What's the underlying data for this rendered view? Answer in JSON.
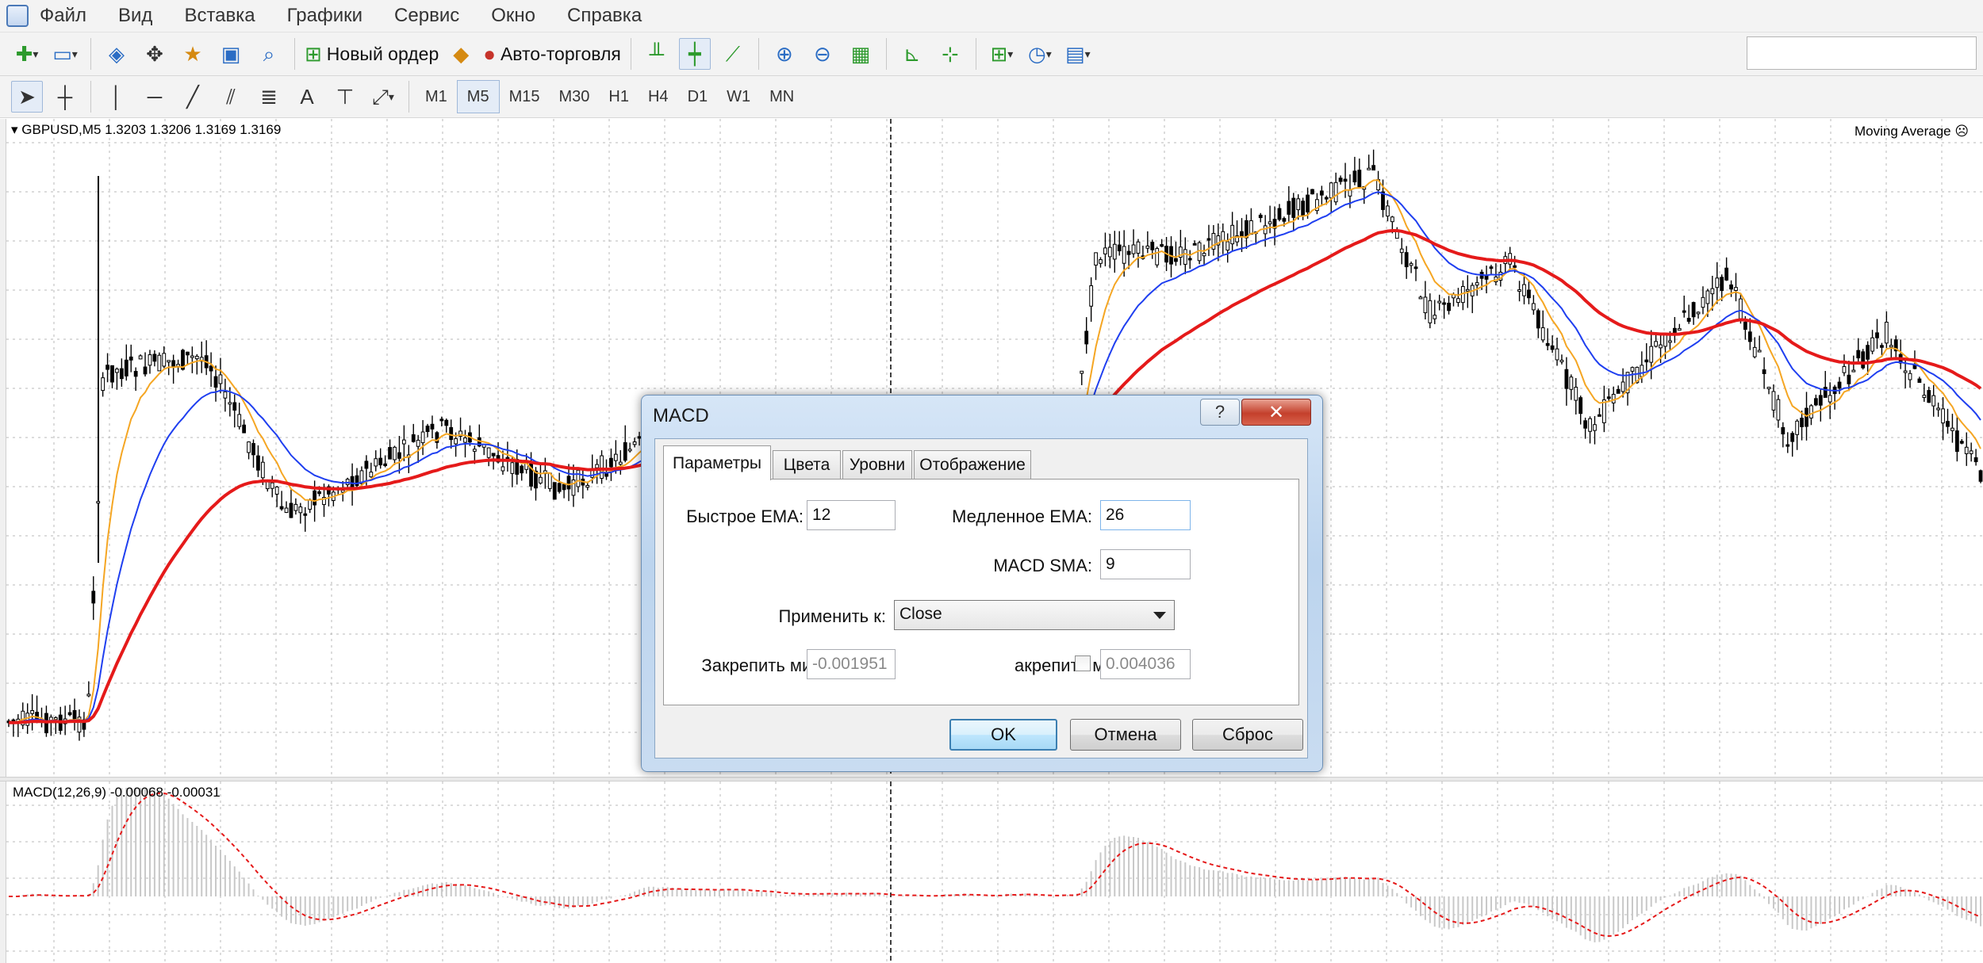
{
  "menu": [
    "Файл",
    "Вид",
    "Вставка",
    "Графики",
    "Сервис",
    "Окно",
    "Справка"
  ],
  "toolbar": {
    "new_order": "Новый ордер",
    "auto_trading": "Авто-торговля"
  },
  "timeframes": [
    "M1",
    "M5",
    "M15",
    "M30",
    "H1",
    "H4",
    "D1",
    "W1",
    "MN"
  ],
  "active_timeframe": "M5",
  "chart": {
    "symbol_info": "GBPUSD,M5  1.3203 1.3206 1.3169 1.3169",
    "indicator_label": "Moving Average",
    "macd_label": "MACD(12,26,9) -0.00068 -0.00031",
    "colors": {
      "fast_ma": "#f5a623",
      "mid_ma": "#1f3ff0",
      "slow_ma": "#e51a1a",
      "signal": "#e51a1a",
      "histogram": "#c8c8c8",
      "grid": "#b9b9b9"
    }
  },
  "dialog": {
    "title": "MACD",
    "help": "?",
    "close": "✕",
    "tabs": [
      "Параметры",
      "Цвета",
      "Уровни",
      "Отображение"
    ],
    "fast_ema_label": "Быстрое EMA:",
    "fast_ema_value": "12",
    "slow_ema_label": "Медленное EMA:",
    "slow_ema_value": "26",
    "macd_sma_label": "MACD SMA:",
    "macd_sma_value": "9",
    "apply_to_label": "Применить к:",
    "apply_to_value": "Close",
    "fix_min_label": "Закрепить минимум",
    "fix_min_value": "-0.001951",
    "fix_max_label": "акрепить максимум",
    "fix_max_value": "0.004036",
    "ok": "OK",
    "cancel": "Отмена",
    "reset": "Сброс"
  }
}
